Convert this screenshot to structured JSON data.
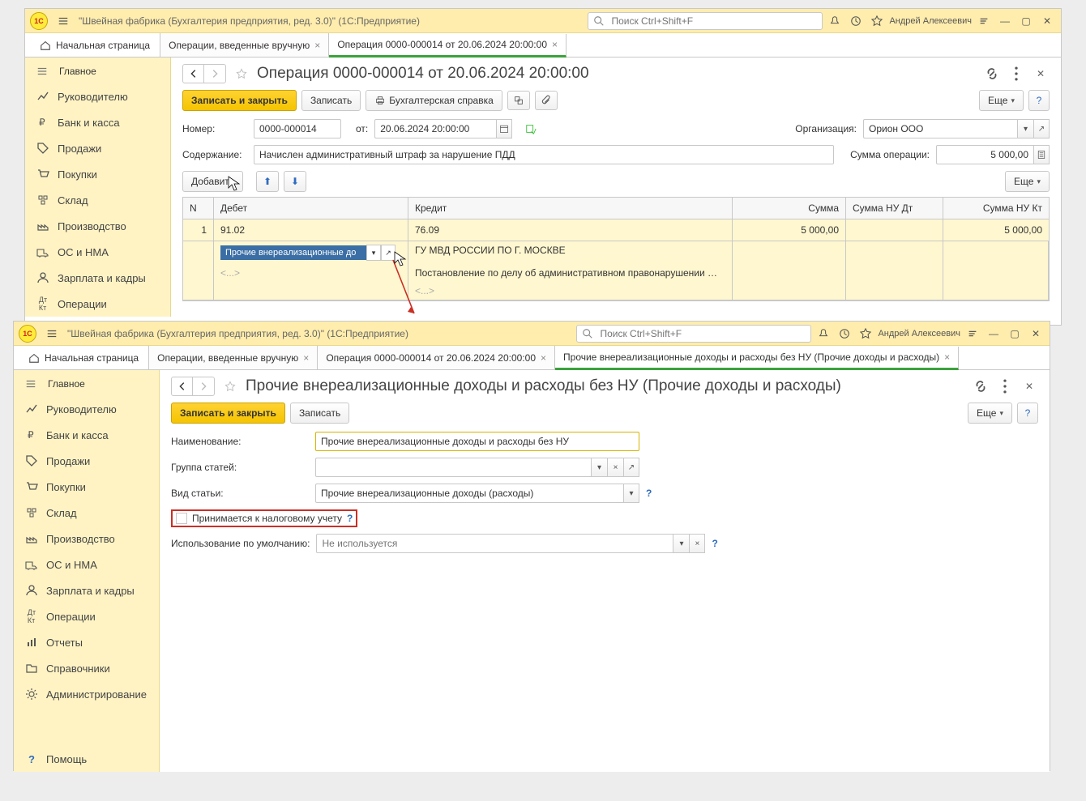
{
  "win1": {
    "titlebar_text": "\"Швейная фабрика (Бухгалтерия предприятия, ред. 3.0)\"  (1С:Предприятие)",
    "search_placeholder": "Поиск Ctrl+Shift+F",
    "user": "Андрей Алексеевич",
    "tabs": {
      "home": "Начальная страница",
      "t1": "Операции, введенные вручную",
      "t2": "Операция 0000-000014 от 20.06.2024 20:00:00"
    },
    "sidebar": {
      "main": "Главное",
      "mgr": "Руководителю",
      "bank": "Банк и касса",
      "sales": "Продажи",
      "purch": "Покупки",
      "stock": "Склад",
      "prod": "Производство",
      "os": "ОС и НМА",
      "salary": "Зарплата и кадры",
      "ops": "Операции"
    },
    "doc": {
      "title": "Операция 0000-000014 от 20.06.2024 20:00:00",
      "save_close": "Записать и закрыть",
      "save": "Записать",
      "print_ref": "Бухгалтерская справка",
      "more": "Еще",
      "num_lbl": "Номер:",
      "num_val": "0000-000014",
      "date_lbl": "от:",
      "date_val": "20.06.2024 20:00:00",
      "org_lbl": "Организация:",
      "org_val": "Орион ООО",
      "content_lbl": "Содержание:",
      "content_val": "Начислен административный штраф за нарушение ПДД",
      "sum_lbl": "Сумма операции:",
      "sum_val": "5 000,00",
      "add": "Добавить",
      "cols": {
        "n": "N",
        "debit": "Дебет",
        "credit": "Кредит",
        "sum": "Сумма",
        "nudt": "Сумма НУ Дт",
        "nukt": "Сумма НУ Кт"
      },
      "row": {
        "n": "1",
        "debit_acc": "91.02",
        "credit_acc": "76.09",
        "sum": "5 000,00",
        "nukt": "5 000,00",
        "debit_sub": "Прочие внереализационные до",
        "credit_sub": "ГУ МВД РОССИИ ПО Г. МОСКВЕ",
        "credit_sub2": "Постановление по делу об административном правонарушении …",
        "empty": "<...>"
      }
    }
  },
  "win2": {
    "titlebar_text": "\"Швейная фабрика (Бухгалтерия предприятия, ред. 3.0)\"  (1С:Предприятие)",
    "search_placeholder": "Поиск Ctrl+Shift+F",
    "user": "Андрей Алексеевич",
    "tabs": {
      "home": "Начальная страница",
      "t1": "Операции, введенные вручную",
      "t2": "Операция 0000-000014 от 20.06.2024 20:00:00",
      "t3": "Прочие внереализационные доходы и расходы без НУ (Прочие доходы и расходы)"
    },
    "sidebar": {
      "main": "Главное",
      "mgr": "Руководителю",
      "bank": "Банк и касса",
      "sales": "Продажи",
      "purch": "Покупки",
      "stock": "Склад",
      "prod": "Производство",
      "os": "ОС и НМА",
      "salary": "Зарплата и кадры",
      "ops": "Операции",
      "reports": "Отчеты",
      "ref": "Справочники",
      "admin": "Администрирование",
      "help": "Помощь"
    },
    "form": {
      "title": "Прочие внереализационные доходы и расходы без НУ (Прочие доходы и расходы)",
      "save_close": "Записать и закрыть",
      "save": "Записать",
      "more": "Еще",
      "name_lbl": "Наименование:",
      "name_val": "Прочие внереализационные доходы и расходы без НУ",
      "group_lbl": "Группа статей:",
      "group_val": "",
      "kind_lbl": "Вид статьи:",
      "kind_val": "Прочие внереализационные доходы (расходы)",
      "tax_lbl": "Принимается к налоговому учету",
      "default_lbl": "Использование по умолчанию:",
      "default_ph": "Не используется"
    }
  }
}
